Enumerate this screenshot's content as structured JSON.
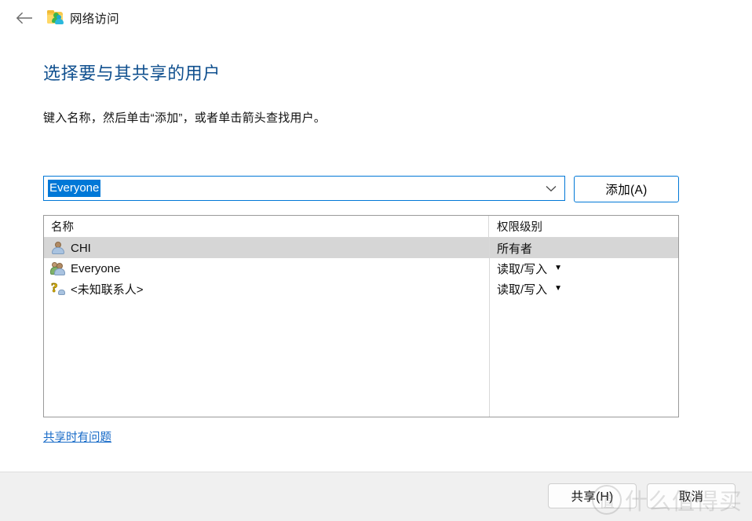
{
  "window": {
    "back_label": "←",
    "title": "网络访问",
    "folder_icon": "shared-folder-icon"
  },
  "page": {
    "heading": "选择要与其共享的用户",
    "subtext": "键入名称，然后单击“添加”，或者单击箭头查找用户。"
  },
  "combo": {
    "value": "Everyone",
    "placeholder": "",
    "arrow_icon": "chevron-down-icon"
  },
  "buttons": {
    "add": "添加(A)",
    "share": "共享(H)",
    "cancel": "取消"
  },
  "list": {
    "columns": [
      "名称",
      "权限级别"
    ],
    "rows": [
      {
        "icon": "user-icon",
        "name": "CHI",
        "permission": "所有者",
        "has_dropdown": false,
        "selected": true
      },
      {
        "icon": "users-group-icon",
        "name": "Everyone",
        "permission": "读取/写入",
        "has_dropdown": true,
        "selected": false
      },
      {
        "icon": "unknown-contact-icon",
        "name": "<未知联系人>",
        "permission": "读取/写入",
        "has_dropdown": true,
        "selected": false
      }
    ],
    "dropdown_caret": "▼"
  },
  "links": {
    "trouble": "共享时有问题"
  },
  "watermark": {
    "badge": "值",
    "text": "什么值得买"
  },
  "colors": {
    "accent": "#0078d7",
    "heading": "#10508f",
    "link": "#1569c7",
    "selection_bg": "#0078d7",
    "row_selected_bg": "#d6d6d6",
    "footer_bg": "#f0f0f0"
  }
}
